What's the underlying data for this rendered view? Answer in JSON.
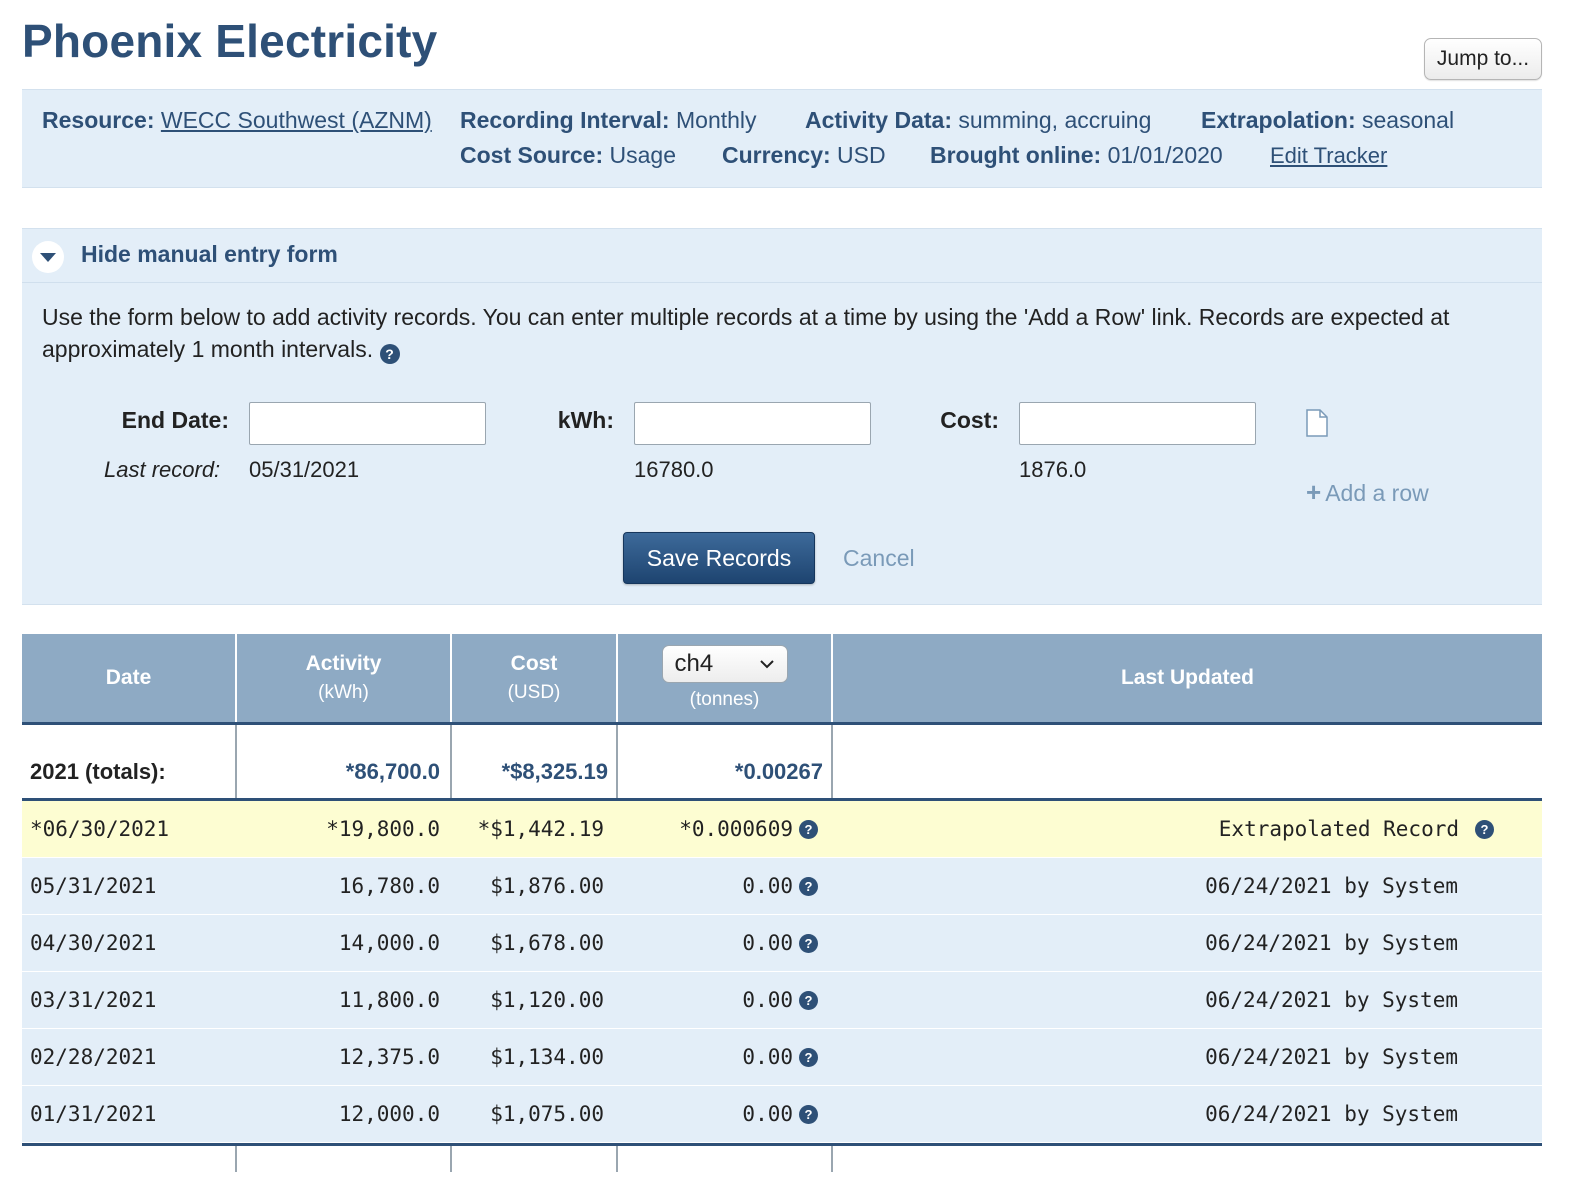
{
  "page": {
    "title": "Phoenix Electricity",
    "jump_label": "Jump to..."
  },
  "meta": {
    "resource_label": "Resource:",
    "resource_value": "WECC Southwest (AZNM)",
    "interval_label": "Recording Interval:",
    "interval_value": "Monthly",
    "activity_label": "Activity Data:",
    "activity_value": "summing, accruing",
    "extrapolation_label": "Extrapolation:",
    "extrapolation_value": "seasonal",
    "cost_source_label": "Cost Source:",
    "cost_source_value": "Usage",
    "currency_label": "Currency:",
    "currency_value": "USD",
    "online_label": "Brought online:",
    "online_value": "01/01/2020",
    "edit_tracker": "Edit Tracker"
  },
  "entry_form": {
    "toggle_label": "Hide manual entry form",
    "description": "Use the form below to add activity records. You can enter multiple records at a time by using the 'Add a Row' link. Records are expected at approximately 1 month intervals.",
    "end_date_label": "End Date:",
    "kwh_label": "kWh:",
    "cost_label": "Cost:",
    "end_date_value": "",
    "kwh_value": "",
    "cost_value": "",
    "last_record_label": "Last record:",
    "last_date": "05/31/2021",
    "last_kwh": "16780.0",
    "last_cost": "1876.0",
    "add_row": "Add a row",
    "save_label": "Save Records",
    "cancel_label": "Cancel"
  },
  "table": {
    "headers": {
      "date": "Date",
      "activity": "Activity",
      "activity_unit": "(kWh)",
      "cost": "Cost",
      "cost_unit": "(USD)",
      "gas_selected": "ch4",
      "gas_unit": "(tonnes)",
      "last_updated": "Last Updated"
    },
    "totals": {
      "label": "2021 (totals):",
      "activity": "*86,700.0",
      "cost": "*$8,325.19",
      "gas": "*0.00267"
    },
    "rows": [
      {
        "date": "*06/30/2021",
        "activity": "*19,800.0",
        "cost": "*$1,442.19",
        "gas": "*0.000609",
        "updated": "Extrapolated Record"
      },
      {
        "date": "05/31/2021",
        "activity": "16,780.0",
        "cost": "$1,876.00",
        "gas": "0.00",
        "updated": "06/24/2021 by System"
      },
      {
        "date": "04/30/2021",
        "activity": "14,000.0",
        "cost": "$1,678.00",
        "gas": "0.00",
        "updated": "06/24/2021 by System"
      },
      {
        "date": "03/31/2021",
        "activity": "11,800.0",
        "cost": "$1,120.00",
        "gas": "0.00",
        "updated": "06/24/2021 by System"
      },
      {
        "date": "02/28/2021",
        "activity": "12,375.0",
        "cost": "$1,134.00",
        "gas": "0.00",
        "updated": "06/24/2021 by System"
      },
      {
        "date": "01/31/2021",
        "activity": "12,000.0",
        "cost": "$1,075.00",
        "gas": "0.00",
        "updated": "06/24/2021 by System"
      }
    ]
  },
  "icons": {
    "help": "question-circle-icon",
    "toggle": "caret-down-icon",
    "document": "document-icon",
    "add": "plus-icon",
    "select": "chevron-down-icon"
  },
  "colors": {
    "brand": "#2e5077",
    "panel": "#e3eef8",
    "header": "#8eaac4",
    "extrapolated": "#fdfdd2",
    "link_muted": "#7a9ab8"
  }
}
